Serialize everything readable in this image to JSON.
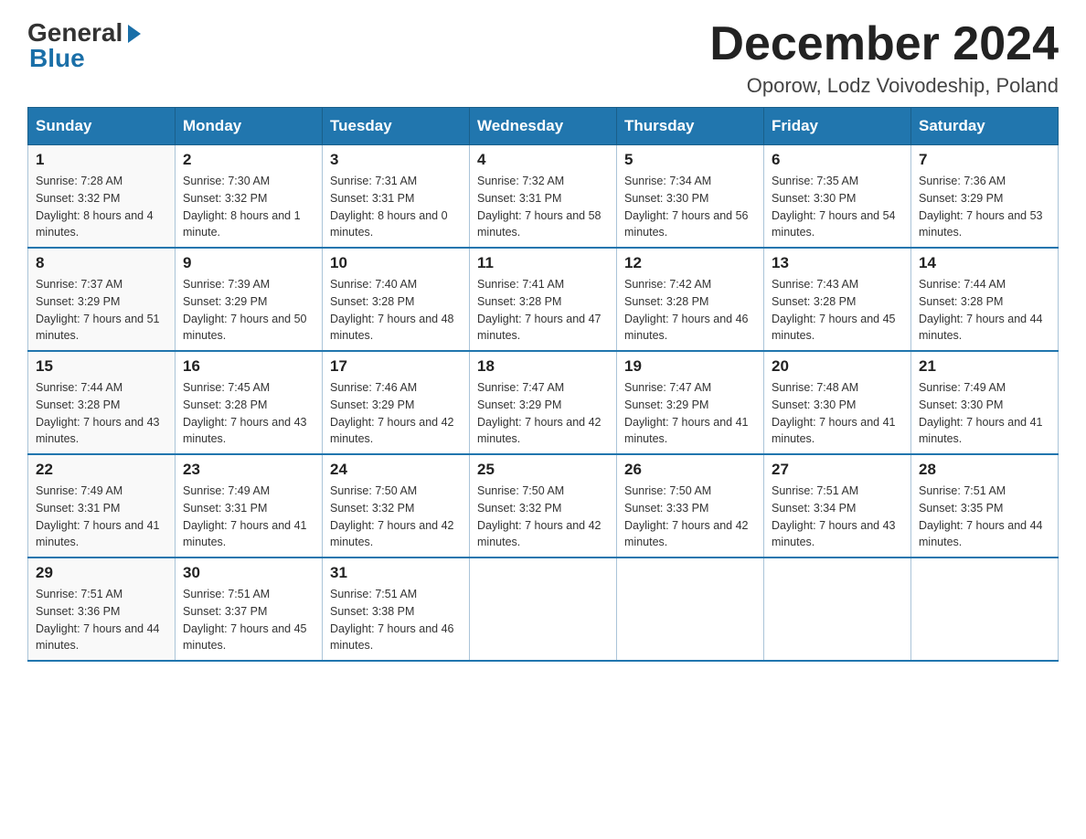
{
  "header": {
    "logo_general": "General",
    "logo_blue": "Blue",
    "month_title": "December 2024",
    "subtitle": "Oporow, Lodz Voivodeship, Poland"
  },
  "days_of_week": [
    "Sunday",
    "Monday",
    "Tuesday",
    "Wednesday",
    "Thursday",
    "Friday",
    "Saturday"
  ],
  "weeks": [
    [
      {
        "day": "1",
        "sunrise": "Sunrise: 7:28 AM",
        "sunset": "Sunset: 3:32 PM",
        "daylight": "Daylight: 8 hours and 4 minutes."
      },
      {
        "day": "2",
        "sunrise": "Sunrise: 7:30 AM",
        "sunset": "Sunset: 3:32 PM",
        "daylight": "Daylight: 8 hours and 1 minute."
      },
      {
        "day": "3",
        "sunrise": "Sunrise: 7:31 AM",
        "sunset": "Sunset: 3:31 PM",
        "daylight": "Daylight: 8 hours and 0 minutes."
      },
      {
        "day": "4",
        "sunrise": "Sunrise: 7:32 AM",
        "sunset": "Sunset: 3:31 PM",
        "daylight": "Daylight: 7 hours and 58 minutes."
      },
      {
        "day": "5",
        "sunrise": "Sunrise: 7:34 AM",
        "sunset": "Sunset: 3:30 PM",
        "daylight": "Daylight: 7 hours and 56 minutes."
      },
      {
        "day": "6",
        "sunrise": "Sunrise: 7:35 AM",
        "sunset": "Sunset: 3:30 PM",
        "daylight": "Daylight: 7 hours and 54 minutes."
      },
      {
        "day": "7",
        "sunrise": "Sunrise: 7:36 AM",
        "sunset": "Sunset: 3:29 PM",
        "daylight": "Daylight: 7 hours and 53 minutes."
      }
    ],
    [
      {
        "day": "8",
        "sunrise": "Sunrise: 7:37 AM",
        "sunset": "Sunset: 3:29 PM",
        "daylight": "Daylight: 7 hours and 51 minutes."
      },
      {
        "day": "9",
        "sunrise": "Sunrise: 7:39 AM",
        "sunset": "Sunset: 3:29 PM",
        "daylight": "Daylight: 7 hours and 50 minutes."
      },
      {
        "day": "10",
        "sunrise": "Sunrise: 7:40 AM",
        "sunset": "Sunset: 3:28 PM",
        "daylight": "Daylight: 7 hours and 48 minutes."
      },
      {
        "day": "11",
        "sunrise": "Sunrise: 7:41 AM",
        "sunset": "Sunset: 3:28 PM",
        "daylight": "Daylight: 7 hours and 47 minutes."
      },
      {
        "day": "12",
        "sunrise": "Sunrise: 7:42 AM",
        "sunset": "Sunset: 3:28 PM",
        "daylight": "Daylight: 7 hours and 46 minutes."
      },
      {
        "day": "13",
        "sunrise": "Sunrise: 7:43 AM",
        "sunset": "Sunset: 3:28 PM",
        "daylight": "Daylight: 7 hours and 45 minutes."
      },
      {
        "day": "14",
        "sunrise": "Sunrise: 7:44 AM",
        "sunset": "Sunset: 3:28 PM",
        "daylight": "Daylight: 7 hours and 44 minutes."
      }
    ],
    [
      {
        "day": "15",
        "sunrise": "Sunrise: 7:44 AM",
        "sunset": "Sunset: 3:28 PM",
        "daylight": "Daylight: 7 hours and 43 minutes."
      },
      {
        "day": "16",
        "sunrise": "Sunrise: 7:45 AM",
        "sunset": "Sunset: 3:28 PM",
        "daylight": "Daylight: 7 hours and 43 minutes."
      },
      {
        "day": "17",
        "sunrise": "Sunrise: 7:46 AM",
        "sunset": "Sunset: 3:29 PM",
        "daylight": "Daylight: 7 hours and 42 minutes."
      },
      {
        "day": "18",
        "sunrise": "Sunrise: 7:47 AM",
        "sunset": "Sunset: 3:29 PM",
        "daylight": "Daylight: 7 hours and 42 minutes."
      },
      {
        "day": "19",
        "sunrise": "Sunrise: 7:47 AM",
        "sunset": "Sunset: 3:29 PM",
        "daylight": "Daylight: 7 hours and 41 minutes."
      },
      {
        "day": "20",
        "sunrise": "Sunrise: 7:48 AM",
        "sunset": "Sunset: 3:30 PM",
        "daylight": "Daylight: 7 hours and 41 minutes."
      },
      {
        "day": "21",
        "sunrise": "Sunrise: 7:49 AM",
        "sunset": "Sunset: 3:30 PM",
        "daylight": "Daylight: 7 hours and 41 minutes."
      }
    ],
    [
      {
        "day": "22",
        "sunrise": "Sunrise: 7:49 AM",
        "sunset": "Sunset: 3:31 PM",
        "daylight": "Daylight: 7 hours and 41 minutes."
      },
      {
        "day": "23",
        "sunrise": "Sunrise: 7:49 AM",
        "sunset": "Sunset: 3:31 PM",
        "daylight": "Daylight: 7 hours and 41 minutes."
      },
      {
        "day": "24",
        "sunrise": "Sunrise: 7:50 AM",
        "sunset": "Sunset: 3:32 PM",
        "daylight": "Daylight: 7 hours and 42 minutes."
      },
      {
        "day": "25",
        "sunrise": "Sunrise: 7:50 AM",
        "sunset": "Sunset: 3:32 PM",
        "daylight": "Daylight: 7 hours and 42 minutes."
      },
      {
        "day": "26",
        "sunrise": "Sunrise: 7:50 AM",
        "sunset": "Sunset: 3:33 PM",
        "daylight": "Daylight: 7 hours and 42 minutes."
      },
      {
        "day": "27",
        "sunrise": "Sunrise: 7:51 AM",
        "sunset": "Sunset: 3:34 PM",
        "daylight": "Daylight: 7 hours and 43 minutes."
      },
      {
        "day": "28",
        "sunrise": "Sunrise: 7:51 AM",
        "sunset": "Sunset: 3:35 PM",
        "daylight": "Daylight: 7 hours and 44 minutes."
      }
    ],
    [
      {
        "day": "29",
        "sunrise": "Sunrise: 7:51 AM",
        "sunset": "Sunset: 3:36 PM",
        "daylight": "Daylight: 7 hours and 44 minutes."
      },
      {
        "day": "30",
        "sunrise": "Sunrise: 7:51 AM",
        "sunset": "Sunset: 3:37 PM",
        "daylight": "Daylight: 7 hours and 45 minutes."
      },
      {
        "day": "31",
        "sunrise": "Sunrise: 7:51 AM",
        "sunset": "Sunset: 3:38 PM",
        "daylight": "Daylight: 7 hours and 46 minutes."
      },
      {
        "day": "",
        "sunrise": "",
        "sunset": "",
        "daylight": ""
      },
      {
        "day": "",
        "sunrise": "",
        "sunset": "",
        "daylight": ""
      },
      {
        "day": "",
        "sunrise": "",
        "sunset": "",
        "daylight": ""
      },
      {
        "day": "",
        "sunrise": "",
        "sunset": "",
        "daylight": ""
      }
    ]
  ]
}
